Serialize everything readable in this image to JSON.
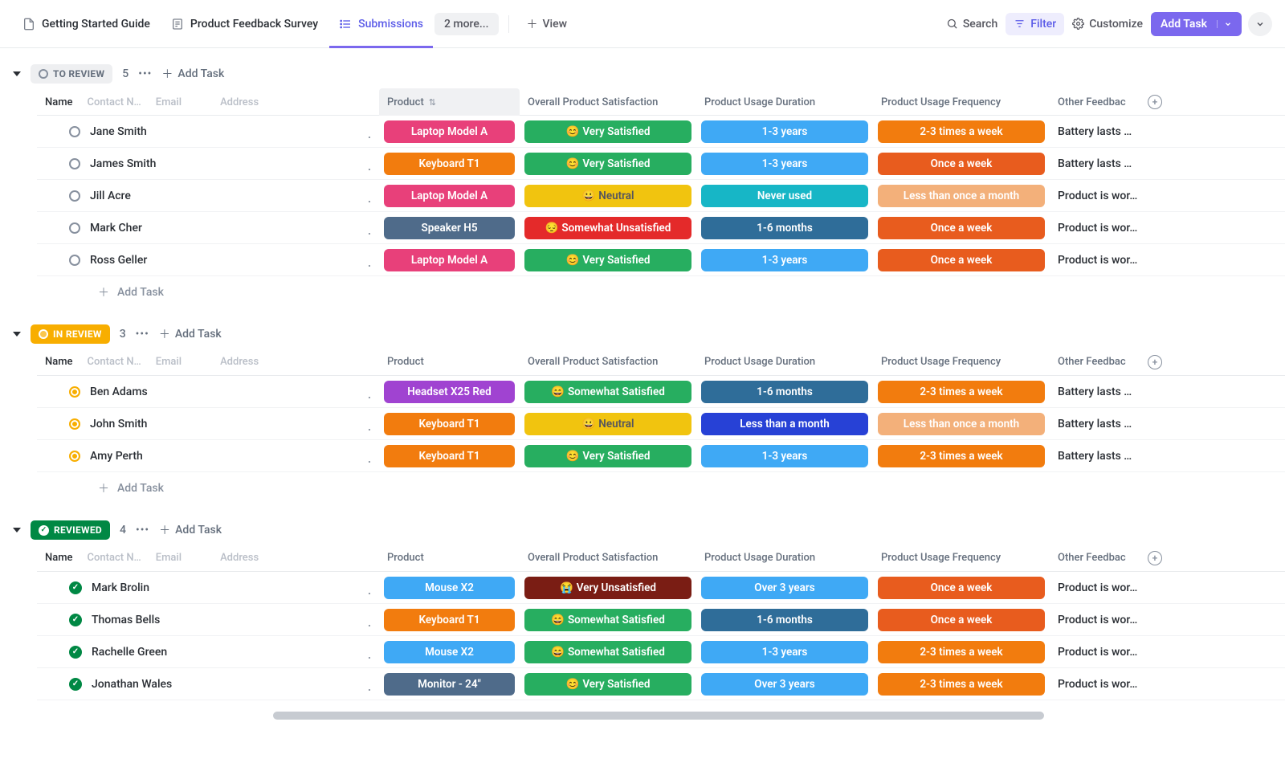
{
  "topbar": {
    "tabs": [
      {
        "label": "Getting Started Guide",
        "icon": "doc"
      },
      {
        "label": "Product Feedback Survey",
        "icon": "form"
      },
      {
        "label": "Submissions",
        "icon": "list",
        "active": true
      }
    ],
    "overflow_label": "2 more...",
    "view_label": "View",
    "search_label": "Search",
    "filter_label": "Filter",
    "customize_label": "Customize",
    "add_task_label": "Add Task"
  },
  "columns": {
    "name": "Name",
    "contact": "Contact N…",
    "email": "Email",
    "address": "Address",
    "product": "Product",
    "satisfaction": "Overall Product Satisfaction",
    "duration": "Product Usage Duration",
    "frequency": "Product Usage Frequency",
    "other": "Other Feedbac"
  },
  "chip_colors": {
    "product": {
      "Laptop Model A": "#e8407a",
      "Keyboard T1": "#f27c0e",
      "Speaker H5": "#4f6b8a",
      "Headset X25 Red": "#a043d1",
      "Mouse X2": "#3fa9f5",
      "Monitor - 24\"": "#4f6b8a"
    },
    "satisfaction": {
      "Very Satisfied": {
        "bg": "#27ae60",
        "emoji": "😊"
      },
      "Somewhat Satisfied": {
        "bg": "#27ae60",
        "emoji": "😄"
      },
      "Neutral": {
        "bg": "#f1c40f",
        "emoji": "😀",
        "fg": "#54555e"
      },
      "Somewhat Unsatisfied": {
        "bg": "#e42a2a",
        "emoji": "😔"
      },
      "Very Unsatisfied": {
        "bg": "#7a1d14",
        "emoji": "😭"
      }
    },
    "duration": {
      "1-3 years": "#3fa9f5",
      "Never used": "#17b6c6",
      "1-6 months": "#2f6d99",
      "Less than a month": "#2741d6",
      "Over 3 years": "#3fa9f5"
    },
    "frequency": {
      "2-3 times a week": "#f27c0e",
      "Once a week": "#e85c1e",
      "Less than once a month": "#f3b07a"
    }
  },
  "groups": [
    {
      "id": "to-review",
      "label": "TO REVIEW",
      "count": "5",
      "add_label": "Add Task",
      "status_style": "grey",
      "sort_product": true,
      "rows": [
        {
          "name": "Jane Smith",
          "product": "Laptop Model A",
          "satisfaction": "Very Satisfied",
          "duration": "1-3 years",
          "frequency": "2-3 times a week",
          "other": "Battery lasts …"
        },
        {
          "name": "James Smith",
          "product": "Keyboard T1",
          "satisfaction": "Very Satisfied",
          "duration": "1-3 years",
          "frequency": "Once a week",
          "other": "Battery lasts …"
        },
        {
          "name": "Jill Acre",
          "product": "Laptop Model A",
          "satisfaction": "Neutral",
          "duration": "Never used",
          "frequency": "Less than once a month",
          "other": "Product is wor…"
        },
        {
          "name": "Mark Cher",
          "product": "Speaker H5",
          "satisfaction": "Somewhat Unsatisfied",
          "duration": "1-6 months",
          "frequency": "Once a week",
          "other": "Product is wor…"
        },
        {
          "name": "Ross Geller",
          "product": "Laptop Model A",
          "satisfaction": "Very Satisfied",
          "duration": "1-3 years",
          "frequency": "Once a week",
          "other": "Product is wor…"
        }
      ]
    },
    {
      "id": "in-review",
      "label": "IN REVIEW",
      "count": "3",
      "add_label": "Add Task",
      "status_style": "amber",
      "rows": [
        {
          "name": "Ben Adams",
          "product": "Headset X25 Red",
          "satisfaction": "Somewhat Satisfied",
          "duration": "1-6 months",
          "frequency": "2-3 times a week",
          "other": "Battery lasts …"
        },
        {
          "name": "John Smith",
          "product": "Keyboard T1",
          "satisfaction": "Neutral",
          "duration": "Less than a month",
          "frequency": "Less than once a month",
          "other": "Battery lasts …"
        },
        {
          "name": "Amy Perth",
          "product": "Keyboard T1",
          "satisfaction": "Very Satisfied",
          "duration": "1-3 years",
          "frequency": "2-3 times a week",
          "other": "Battery lasts …"
        }
      ]
    },
    {
      "id": "reviewed",
      "label": "REVIEWED",
      "count": "4",
      "add_label": "Add Task",
      "status_style": "check",
      "rows": [
        {
          "name": "Mark Brolin",
          "product": "Mouse X2",
          "satisfaction": "Very Unsatisfied",
          "duration": "Over 3 years",
          "frequency": "Once a week",
          "other": "Product is wor…"
        },
        {
          "name": "Thomas Bells",
          "product": "Keyboard T1",
          "satisfaction": "Somewhat Satisfied",
          "duration": "1-6 months",
          "frequency": "Once a week",
          "other": "Product is wor…"
        },
        {
          "name": "Rachelle Green",
          "product": "Mouse X2",
          "satisfaction": "Somewhat Satisfied",
          "duration": "1-3 years",
          "frequency": "2-3 times a week",
          "other": "Product is wor…"
        },
        {
          "name": "Jonathan Wales",
          "product": "Monitor - 24\"",
          "satisfaction": "Very Satisfied",
          "duration": "Over 3 years",
          "frequency": "2-3 times a week",
          "other": "Product is wor…"
        }
      ]
    }
  ],
  "add_task_row_label": "Add Task"
}
